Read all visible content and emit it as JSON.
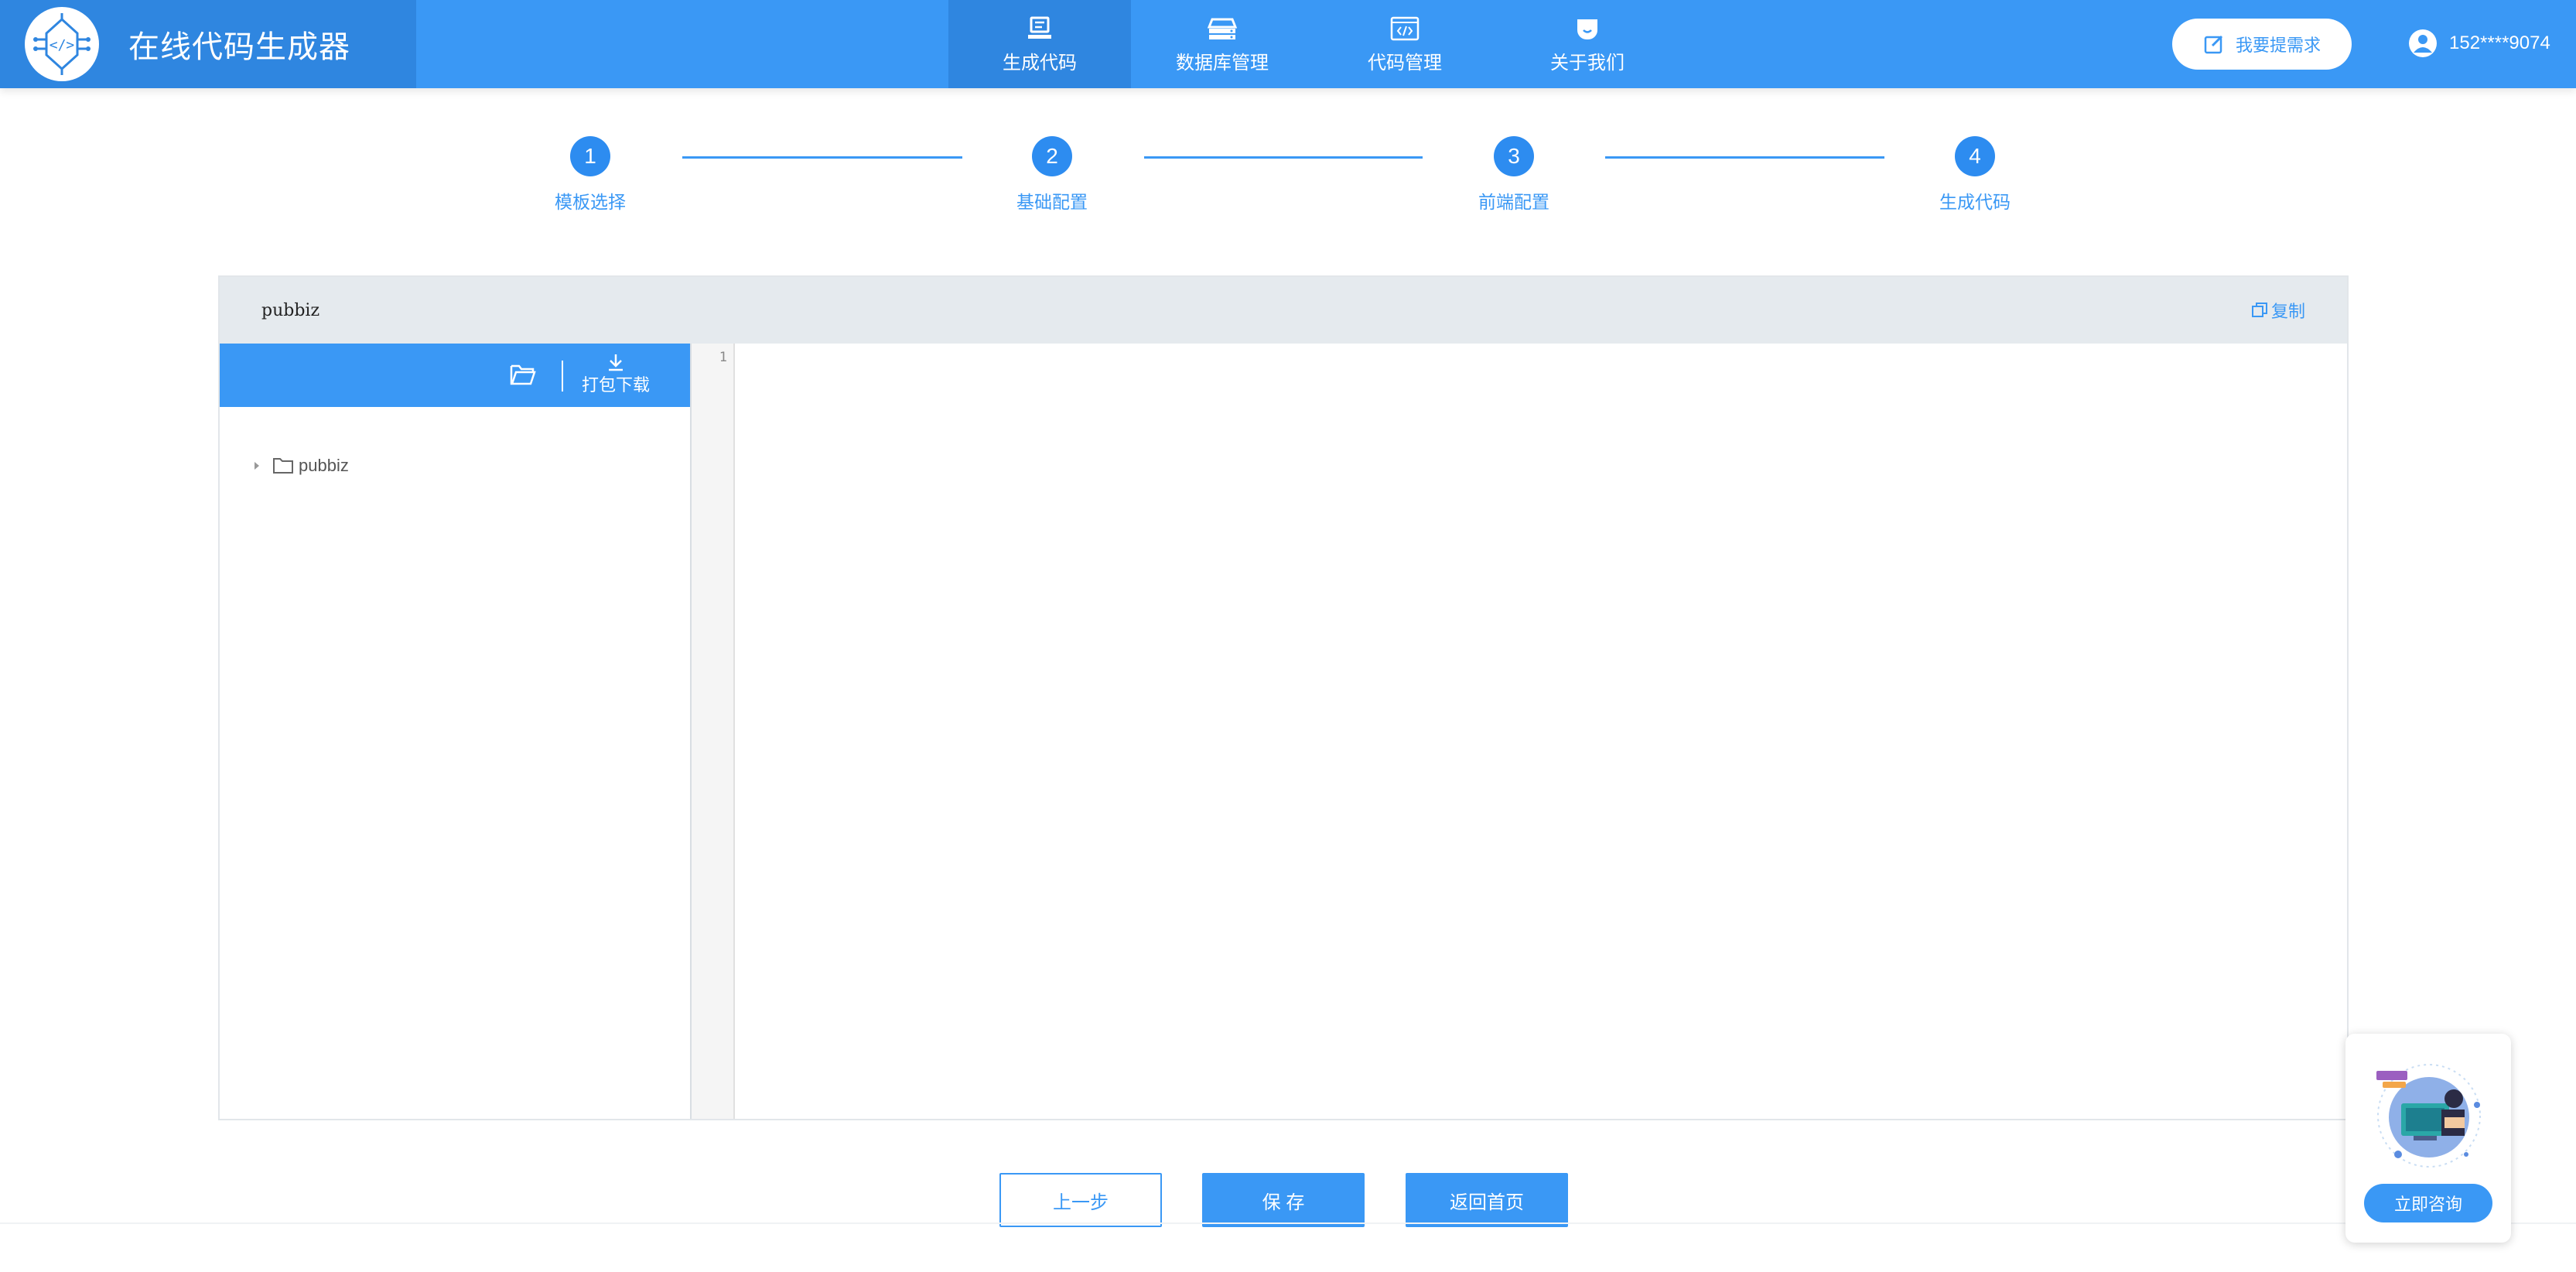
{
  "header": {
    "brand_title": "在线代码生成器",
    "nav": [
      {
        "label": "生成代码",
        "icon": "monitor-icon",
        "active": true
      },
      {
        "label": "数据库管理",
        "icon": "database-icon",
        "active": false
      },
      {
        "label": "代码管理",
        "icon": "code-window-icon",
        "active": false
      },
      {
        "label": "关于我们",
        "icon": "chat-bubble-icon",
        "active": false
      }
    ],
    "request_button": "我要提需求",
    "user_phone": "152****9074"
  },
  "steps": [
    {
      "number": "1",
      "label": "模板选择"
    },
    {
      "number": "2",
      "label": "基础配置"
    },
    {
      "number": "3",
      "label": "前端配置"
    },
    {
      "number": "4",
      "label": "生成代码"
    }
  ],
  "panel": {
    "title": "pubbiz",
    "copy_label": "复制",
    "download_label": "打包下载",
    "tree": [
      {
        "label": "pubbiz"
      }
    ],
    "editor": {
      "line_numbers": [
        "1"
      ]
    }
  },
  "footer": {
    "prev_label": "上一步",
    "save_label": "保 存",
    "home_label": "返回首页"
  },
  "consult": {
    "button_label": "立即咨询"
  },
  "colors": {
    "primary": "#3a98f5",
    "primary_dark": "#2f86e0",
    "panel_header": "#e5eaee"
  }
}
